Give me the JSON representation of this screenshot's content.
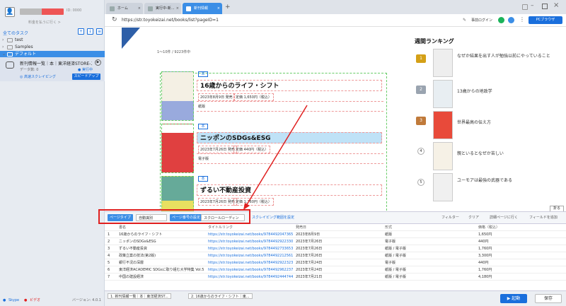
{
  "sidebar": {
    "account_id": "ID: 0000",
    "account_sub": "料金を払うに行く >",
    "tree_title": "全てのタスク",
    "folders": [
      "test",
      "Samples"
    ],
    "default_folder": "デフォルト",
    "task": {
      "title": "新刊情報一覧｜本｜東洋経済STORE-スク...",
      "count_label": "データ数: 0",
      "status": "● 実行中",
      "cloud_label": "◎ 高速スクレイピング",
      "speedup": "スピードアップ"
    },
    "footer": {
      "skype": "Skype",
      "video": "ビデオ",
      "version": "バージョン: 4.0.1"
    }
  },
  "browser": {
    "tabs": [
      "ホーム",
      "実行中-新...",
      "新刊情報"
    ],
    "active_tab": 2,
    "new_tab": "+",
    "toolbar_right": {
      "login": "事前ログイン",
      "pc_browser": "PCブラウザ"
    },
    "url": "https://str.toyokeizai.net/books/list?pageID=1"
  },
  "page": {
    "count_text": "1〜10件 / 9223件中",
    "books": [
      {
        "badge": "本",
        "title": "16歳からのライフ・シフト",
        "date": "2023年8月9日 発売",
        "price": "定価 1,650円（税込）",
        "format": "紙版"
      },
      {
        "badge": "本",
        "title": "ニッポンのSDGs&ESG",
        "date": "2023年7月26日 発売",
        "price": "定価 440円（税込）",
        "format": "電子版"
      },
      {
        "badge": "本",
        "title": "ずるい不動産投資",
        "date": "2023年7月26日 発売",
        "price": "定価 1,760円（税込）",
        "format": ""
      }
    ],
    "ranking": {
      "title": "週間ランキング",
      "items": [
        {
          "rank": "1",
          "text": "なぜか結果を出す人が勉強以前にやっていること"
        },
        {
          "rank": "2",
          "text": "13歳からの地政学"
        },
        {
          "rank": "3",
          "text": "世界最高の伝え方"
        },
        {
          "rank": "4",
          "text": "親といるとなぜか苦しい"
        },
        {
          "rank": "5",
          "text": "ユーモアは最強の武器である"
        }
      ]
    },
    "collapse": "折る"
  },
  "extract_toolbar": {
    "page_type_label": "ページタイプ",
    "page_type_value": "自動識別",
    "page_setting_label": "ページ番号の設定",
    "page_setting_value": "スクロールローディン",
    "scrape_range": "スクレイピング範囲を設定",
    "filter": "フィルター",
    "clear": "クリア",
    "goto_detail": "詳細ページに行く",
    "add_field": "フィールドを追加"
  },
  "table": {
    "headers": [
      "書名",
      "タイトルリンク",
      "発売日",
      "形式",
      "価格（税込）"
    ],
    "rows": [
      [
        "1",
        "16歳からのライフ・シフト",
        "https://str.toyokeizai.net/books/9784492047365/",
        "2023年8月9日",
        "紙版",
        "1,650円"
      ],
      [
        "2",
        "ニッポンのSDGs&ESG",
        "https://str.toyokeizai.net/books/9784492922330/",
        "2023年7月26日",
        "電子版",
        "440円"
      ],
      [
        "3",
        "ずるい不動産投資",
        "https://str.toyokeizai.net/books/9784492733653/",
        "2023年7月26日",
        "紙版 / 電子版",
        "1,760円"
      ],
      [
        "4",
        "政策立案の技法(第2版)",
        "https://str.toyokeizai.net/books/9784492212561/",
        "2023年7月26日",
        "紙版 / 電子版",
        "3,300円"
      ],
      [
        "5",
        "銀行不況の深層",
        "https://str.toyokeizai.net/books/9784492922323/",
        "2023年7月24日",
        "電子版",
        "440円"
      ],
      [
        "6",
        "東洋経済ACADEMIC SDGsに取り組む大学特集 Vol.5",
        "https://str.toyokeizai.net/books/9784492962237/",
        "2023年7月24日",
        "紙版 / 電子版",
        "1,760円"
      ],
      [
        "7",
        "中国の建設経済",
        "https://str.toyokeizai.net/books/9784492444744/",
        "2023年7月21日",
        "紙版 / 電子版",
        "4,180円"
      ]
    ]
  },
  "bottom": {
    "tabs": [
      "1. 新刊情報一覧｜本｜東洋経済ST...",
      "2. 16歳からのライフ・シフト｜東..."
    ],
    "start": "▶ 起動",
    "save": "保存"
  },
  "colors": {
    "accent": "#1a6fdc",
    "active_tab": "#3b8ee6",
    "highlight": "#e02020"
  }
}
